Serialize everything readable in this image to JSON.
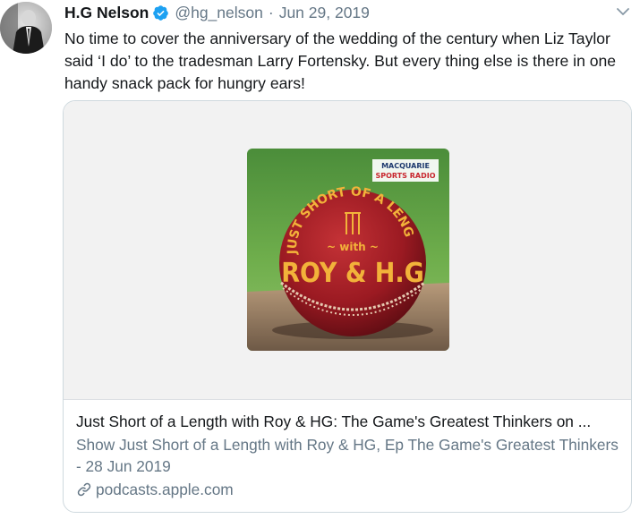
{
  "tweet": {
    "author_name": "H.G Nelson",
    "handle": "@hg_nelson",
    "separator": "·",
    "date": "Jun 29, 2019",
    "text": "No time to cover the anniversary of the wedding of the century when Liz Taylor said ‘I do’ to the tradesman Larry Fortensky. But every thing else is there in one handy snack pack for hungry ears!"
  },
  "card": {
    "title": "Just Short of a Length with Roy & HG: The Game's Greatest Thinkers on ...",
    "description": "Show Just Short of a Length with Roy & HG, Ep The Game's Greatest Thinkers - 28 Jun 2019",
    "domain": "podcasts.apple.com",
    "artwork": {
      "badge_line1": "MACQUARIE",
      "badge_line2": "SPORTS RADIO",
      "arc_text": "JUST SHORT OF A LENGTH",
      "with_text": "~ with ~",
      "names_text": "ROY & H.G"
    }
  },
  "icons": {
    "verified": "verified-badge-icon",
    "caret": "chevron-down-icon",
    "link": "link-icon"
  },
  "colors": {
    "verified_blue": "#1da1f2",
    "secondary_text": "#657786",
    "primary_text": "#14171a"
  }
}
